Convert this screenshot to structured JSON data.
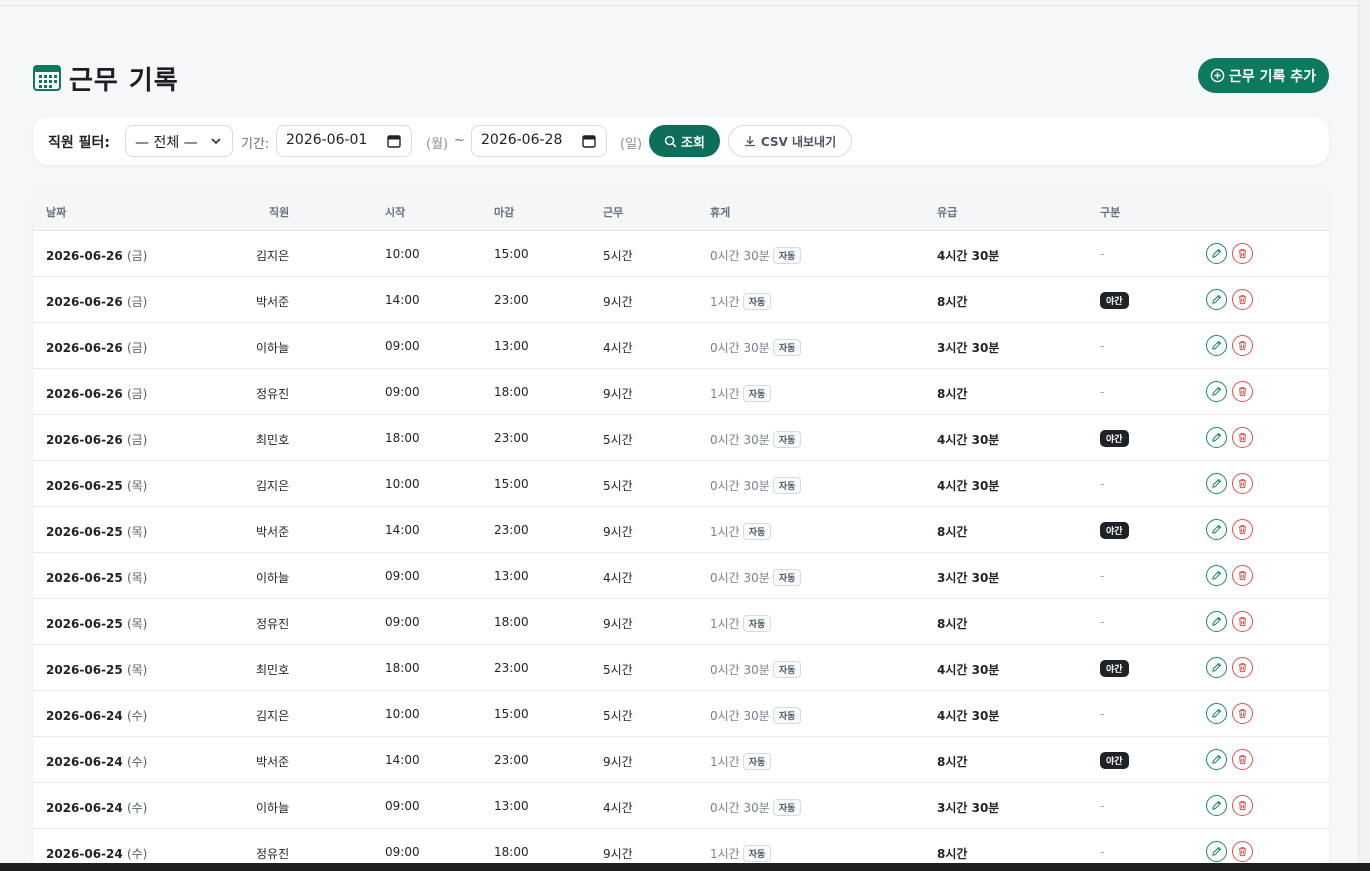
{
  "page": {
    "title": "근무 기록",
    "add_button": "근무 기록 추가"
  },
  "filter": {
    "employee_label": "직원 필터:",
    "employee_selected": "— 전체 —",
    "period_label": "기간:",
    "start_date": "2026-06-01",
    "start_dow": "(월)",
    "tilde": "~",
    "end_date": "2026-06-28",
    "end_dow": "(일)",
    "search_button": "조회",
    "csv_button": "CSV 내보내기"
  },
  "table": {
    "headers": {
      "date": "날짜",
      "employee": "직원",
      "start": "시작",
      "end": "마감",
      "work": "근무",
      "break": "휴게",
      "paid": "유급",
      "category": "구분"
    },
    "auto_label": "자동",
    "night_label": "야간",
    "rows": [
      {
        "date": "2026-06-26",
        "dow": "(금)",
        "employee": "김지은",
        "start": "10:00",
        "end": "15:00",
        "work": "5시간",
        "break": "0시간 30분",
        "paid": "4시간 30분",
        "category": "-"
      },
      {
        "date": "2026-06-26",
        "dow": "(금)",
        "employee": "박서준",
        "start": "14:00",
        "end": "23:00",
        "work": "9시간",
        "break": "1시간",
        "paid": "8시간",
        "category": "야간"
      },
      {
        "date": "2026-06-26",
        "dow": "(금)",
        "employee": "이하늘",
        "start": "09:00",
        "end": "13:00",
        "work": "4시간",
        "break": "0시간 30분",
        "paid": "3시간 30분",
        "category": "-"
      },
      {
        "date": "2026-06-26",
        "dow": "(금)",
        "employee": "정유진",
        "start": "09:00",
        "end": "18:00",
        "work": "9시간",
        "break": "1시간",
        "paid": "8시간",
        "category": "-"
      },
      {
        "date": "2026-06-26",
        "dow": "(금)",
        "employee": "최민호",
        "start": "18:00",
        "end": "23:00",
        "work": "5시간",
        "break": "0시간 30분",
        "paid": "4시간 30분",
        "category": "야간"
      },
      {
        "date": "2026-06-25",
        "dow": "(목)",
        "employee": "김지은",
        "start": "10:00",
        "end": "15:00",
        "work": "5시간",
        "break": "0시간 30분",
        "paid": "4시간 30분",
        "category": "-"
      },
      {
        "date": "2026-06-25",
        "dow": "(목)",
        "employee": "박서준",
        "start": "14:00",
        "end": "23:00",
        "work": "9시간",
        "break": "1시간",
        "paid": "8시간",
        "category": "야간"
      },
      {
        "date": "2026-06-25",
        "dow": "(목)",
        "employee": "이하늘",
        "start": "09:00",
        "end": "13:00",
        "work": "4시간",
        "break": "0시간 30분",
        "paid": "3시간 30분",
        "category": "-"
      },
      {
        "date": "2026-06-25",
        "dow": "(목)",
        "employee": "정유진",
        "start": "09:00",
        "end": "18:00",
        "work": "9시간",
        "break": "1시간",
        "paid": "8시간",
        "category": "-"
      },
      {
        "date": "2026-06-25",
        "dow": "(목)",
        "employee": "최민호",
        "start": "18:00",
        "end": "23:00",
        "work": "5시간",
        "break": "0시간 30분",
        "paid": "4시간 30분",
        "category": "야간"
      },
      {
        "date": "2026-06-24",
        "dow": "(수)",
        "employee": "김지은",
        "start": "10:00",
        "end": "15:00",
        "work": "5시간",
        "break": "0시간 30분",
        "paid": "4시간 30분",
        "category": "-"
      },
      {
        "date": "2026-06-24",
        "dow": "(수)",
        "employee": "박서준",
        "start": "14:00",
        "end": "23:00",
        "work": "9시간",
        "break": "1시간",
        "paid": "8시간",
        "category": "야간"
      },
      {
        "date": "2026-06-24",
        "dow": "(수)",
        "employee": "이하늘",
        "start": "09:00",
        "end": "13:00",
        "work": "4시간",
        "break": "0시간 30분",
        "paid": "3시간 30분",
        "category": "-"
      },
      {
        "date": "2026-06-24",
        "dow": "(수)",
        "employee": "정유진",
        "start": "09:00",
        "end": "18:00",
        "work": "9시간",
        "break": "1시간",
        "paid": "8시간",
        "category": "-"
      }
    ]
  },
  "icons": {
    "title": "calendar-icon",
    "add": "plus-circle-icon",
    "select": "chevron-down-icon",
    "date": "calendar-icon",
    "search": "search-icon",
    "csv": "download-icon",
    "edit": "pencil-icon",
    "delete": "trash-icon"
  },
  "colors": {
    "primary": "#0d7a5f",
    "search": "#0d6e5c",
    "edit": "#1a8a6b",
    "delete": "#d9534f",
    "night_badge": "#1f2328"
  }
}
